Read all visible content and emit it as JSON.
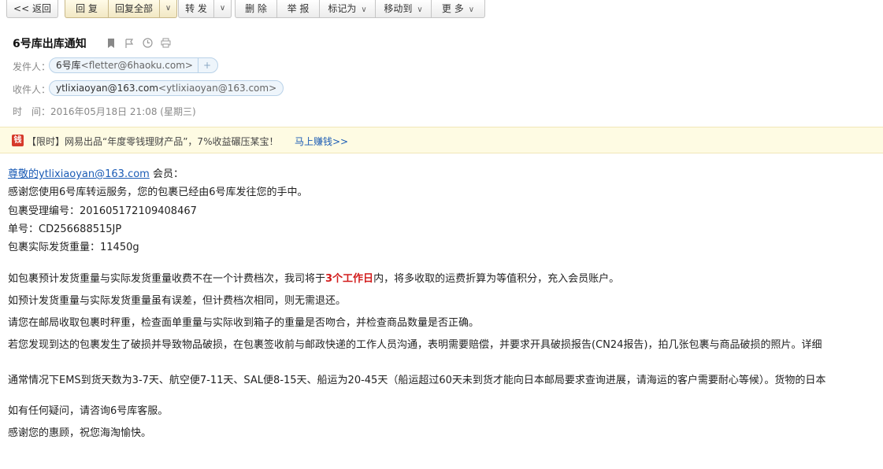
{
  "toolbar": {
    "back": "<< 返回",
    "reply": "回 复",
    "reply_all": "回复全部",
    "forward": "转 发",
    "delete": "删 除",
    "report": "举 报",
    "mark_as": "标记为",
    "move_to": "移动到",
    "more": "更 多"
  },
  "email": {
    "subject": "6号库出库通知",
    "from_label": "发件人：",
    "from_name": "6号库",
    "from_addr": "<fletter@6haoku.com>",
    "to_label": "收件人：",
    "to_name": "ytlixiaoyan@163.com",
    "to_addr": "<ytlixiaoyan@163.com>",
    "time_label": "时　间：",
    "time_value": "2016年05月18日 21:08 (星期三)"
  },
  "ad": {
    "icon_text": "钱",
    "text": "【限时】网易出品“年度零钱理财产品”，7%收益碾压某宝！",
    "link": "马上赚钱>>"
  },
  "body": {
    "greeting_link": "尊敬的ytlixiaoyan@163.com",
    "greeting_suffix": " 会员：",
    "line1": "感谢您使用6号库转运服务，您的包裹已经由6号库发往您的手中。",
    "line2": "包裹受理编号：201605172109408467",
    "line3": "单号：CD256688515JP",
    "line4": "包裹实际发货重量：11450g",
    "p1_pre": "如包裹预计发货重量与实际发货重量收费不在一个计费档次，我司将于",
    "p1_red": "3个工作日",
    "p1_post": "内，将多收取的运费折算为等值积分，充入会员账户。",
    "p2": "如预计发货重量与实际发货重量虽有误差，但计费档次相同，则无需退还。",
    "p3": "请您在邮局收取包裹时秤重，检查面单重量与实际收到箱子的重量是否吻合，并检查商品数量是否正确。",
    "p4": "若您发现到达的包裹发生了破损并导致物品破损，在包裹签收前与邮政快递的工作人员沟通，表明需要赔偿，并要求开具破损报告(CN24报告)，拍几张包裹与商品破损的照片。详细",
    "p5": "通常情况下EMS到货天数为3-7天、航空便7-11天、SAL便8-15天、船运为20-45天（船运超过60天未到货才能向日本邮局要求查询进展，请海运的客户需要耐心等候）。货物的日本",
    "p6": "如有任何疑问，请咨询6号库客服。",
    "p7": "感谢您的惠顾，祝您海淘愉快。"
  }
}
